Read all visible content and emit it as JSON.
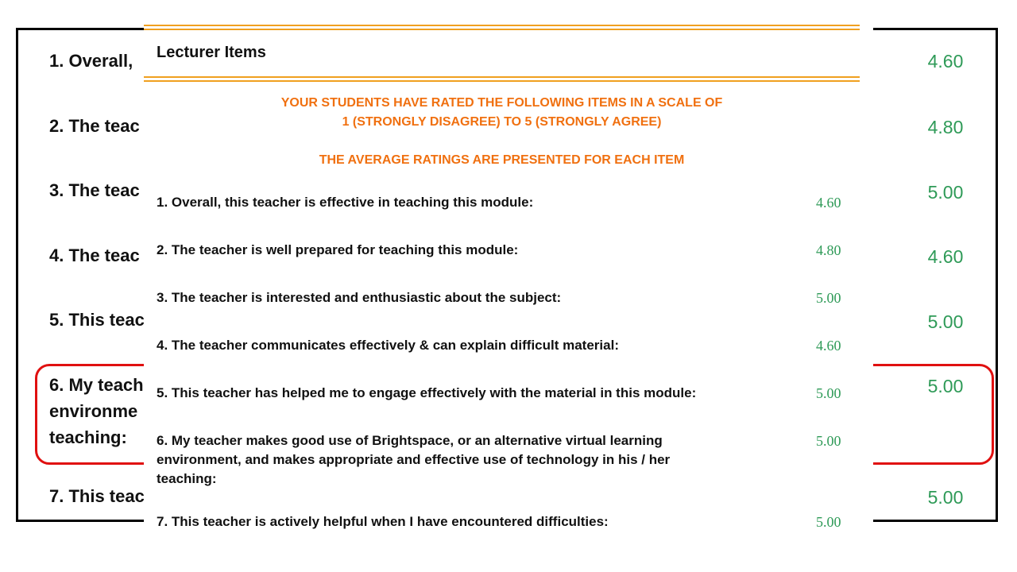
{
  "background_slide": {
    "items": [
      {
        "label": "1. Overall,",
        "score": "4.60"
      },
      {
        "label": "2. The teac",
        "score": "4.80"
      },
      {
        "label": "3. The teac",
        "score": "5.00"
      },
      {
        "label": "4. The teac",
        "score": "4.60"
      },
      {
        "label": "5. This teac",
        "score": "5.00"
      },
      {
        "label": "6. My teach",
        "label_line2": "environme",
        "label_line3": "teaching:",
        "score": "5.00"
      },
      {
        "label": "7. This teac",
        "score": "5.00"
      }
    ]
  },
  "panel": {
    "title": "Lecturer Items",
    "banner_line1": "YOUR STUDENTS HAVE RATED THE FOLLOWING ITEMS IN A SCALE OF",
    "banner_line2": "1 (STRONGLY DISAGREE) TO 5 (STRONGLY AGREE)",
    "banner_line3": "THE AVERAGE RATINGS ARE PRESENTED FOR EACH ITEM",
    "items": [
      {
        "label": "1. Overall, this teacher is effective in teaching this module:",
        "score": "4.60"
      },
      {
        "label": "2. The teacher is well prepared for teaching this module:",
        "score": "4.80"
      },
      {
        "label": "3. The teacher is interested and enthusiastic about the subject:",
        "score": "5.00"
      },
      {
        "label": "4. The teacher communicates effectively & can explain difficult material:",
        "score": "4.60"
      },
      {
        "label": "5. This teacher has helped me to engage effectively with the material in this module:",
        "score": "5.00"
      },
      {
        "label": "6. My teacher makes good use of Brightspace, or an alternative virtual learning environment, and makes appropriate and effective use of technology in his / her teaching:",
        "score": "5.00"
      },
      {
        "label": "7. This teacher is actively helpful when I have encountered difficulties:",
        "score": "5.00"
      }
    ]
  },
  "colors": {
    "banner": "#f07010",
    "score": "#2e9a57",
    "rule": "#f0a020",
    "highlight": "#e01010"
  }
}
